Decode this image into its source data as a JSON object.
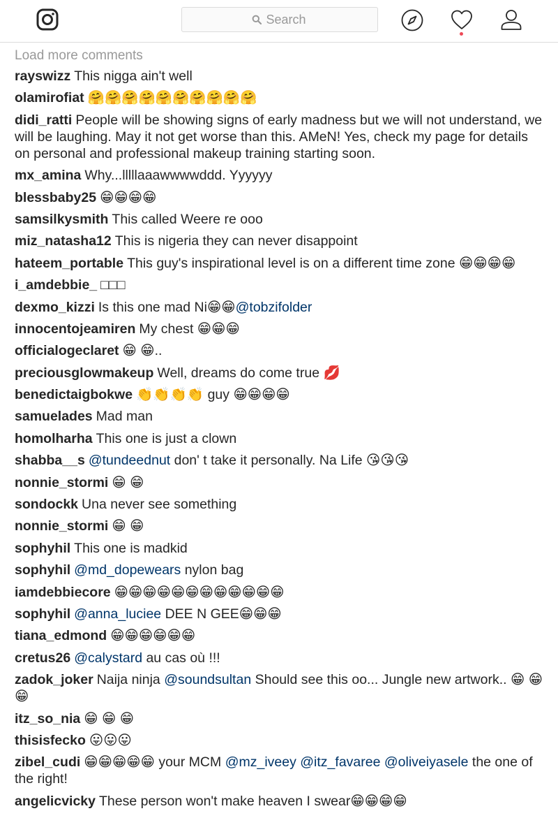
{
  "header": {
    "search_placeholder": "Search",
    "icons": [
      "instagram-logo-icon",
      "search-icon",
      "compass-icon",
      "heart-icon",
      "profile-icon"
    ],
    "notification_dot_color": "#ed4956"
  },
  "load_more_label": "Load more comments",
  "comments": [
    {
      "user": "rayswizz",
      "text": [
        {
          "t": "This nigga ain't well"
        }
      ]
    },
    {
      "user": "olamirofiat",
      "text": [
        {
          "t": "🤗🤗🤗🤗🤗🤗🤗🤗🤗🤗"
        }
      ]
    },
    {
      "user": "didi_ratti",
      "text": [
        {
          "t": "People will be showing signs of early madness but we will not understand, we will be laughing. May it not get worse than this. AMeN! Yes, check my page for details on personal and professional makeup training starting soon."
        }
      ]
    },
    {
      "user": "mx_amina",
      "text": [
        {
          "t": "Why...lllllaaawwwwddd. Yyyyyy"
        }
      ]
    },
    {
      "user": "blessbaby25",
      "text": [
        {
          "t": "😁😁😁😁"
        }
      ]
    },
    {
      "user": "samsilkysmith",
      "text": [
        {
          "t": "This called Weere re ooo"
        }
      ]
    },
    {
      "user": "miz_natasha12",
      "text": [
        {
          "t": "This is nigeria they can never disappoint"
        }
      ]
    },
    {
      "user": "hateem_portable",
      "text": [
        {
          "t": "This guy's inspirational level is on a different time zone 😁😁😁😁"
        }
      ]
    },
    {
      "user": "i_amdebbie_",
      "text": [
        {
          "t": "□□□"
        }
      ]
    },
    {
      "user": "dexmo_kizzi",
      "text": [
        {
          "t": "Is this one mad Ni😁😁"
        },
        {
          "t": "@tobzifolder",
          "m": true
        }
      ]
    },
    {
      "user": "innocentojeamiren",
      "text": [
        {
          "t": "My chest 😁😁😁"
        }
      ]
    },
    {
      "user": "officialogeclaret",
      "text": [
        {
          "t": "😁 😁.."
        }
      ]
    },
    {
      "user": "preciousglowmakeup",
      "text": [
        {
          "t": "Well, dreams do come true 💋"
        }
      ]
    },
    {
      "user": "benedictaigbokwe",
      "text": [
        {
          "t": "👏👏👏👏 guy 😁😁😁😁"
        }
      ]
    },
    {
      "user": "samuelades",
      "text": [
        {
          "t": "Mad man"
        }
      ]
    },
    {
      "user": "homolharha",
      "text": [
        {
          "t": "This one is just a clown"
        }
      ]
    },
    {
      "user": "shabba__s",
      "text": [
        {
          "t": "@tundeednut",
          "m": true
        },
        {
          "t": " don' t take it personally. Na Life 😘😘😘"
        }
      ]
    },
    {
      "user": "nonnie_stormi",
      "text": [
        {
          "t": "😁 😁"
        }
      ]
    },
    {
      "user": "sondockk",
      "text": [
        {
          "t": "Una never see something"
        }
      ]
    },
    {
      "user": "nonnie_stormi",
      "text": [
        {
          "t": "😁 😁"
        }
      ]
    },
    {
      "user": "sophyhil",
      "text": [
        {
          "t": "This one is madkid"
        }
      ]
    },
    {
      "user": "sophyhil",
      "text": [
        {
          "t": "@md_dopewears",
          "m": true
        },
        {
          "t": " nylon bag"
        }
      ]
    },
    {
      "user": "iamdebbiecore",
      "text": [
        {
          "t": "😁😁😁😁😁😁😁😁😁😁😁😁"
        }
      ]
    },
    {
      "user": "sophyhil",
      "text": [
        {
          "t": "@anna_luciee",
          "m": true
        },
        {
          "t": " DEE N GEE😁😁😁"
        }
      ]
    },
    {
      "user": "tiana_edmond",
      "text": [
        {
          "t": "😁😁😁😁😁😁"
        }
      ]
    },
    {
      "user": "cretus26",
      "text": [
        {
          "t": "@calystard",
          "m": true
        },
        {
          "t": " au cas où !!!"
        }
      ]
    },
    {
      "user": "zadok_joker",
      "text": [
        {
          "t": "Naija ninja "
        },
        {
          "t": "@soundsultan",
          "m": true
        },
        {
          "t": " Should see this oo... Jungle new artwork.. 😁 😁 😁"
        }
      ]
    },
    {
      "user": "itz_so_nia",
      "text": [
        {
          "t": "😁 😁 😁"
        }
      ]
    },
    {
      "user": "thisisfecko",
      "text": [
        {
          "t": "😛😛😛"
        }
      ]
    },
    {
      "user": "zibel_cudi",
      "text": [
        {
          "t": "😁😁😁😁😁 your MCM "
        },
        {
          "t": "@mz_iveey",
          "m": true
        },
        {
          "t": " "
        },
        {
          "t": "@itz_favaree",
          "m": true
        },
        {
          "t": " "
        },
        {
          "t": "@oliveiyasele",
          "m": true
        },
        {
          "t": " the one of the right!"
        }
      ]
    },
    {
      "user": "angelicvicky",
      "text": [
        {
          "t": "These person won't make heaven I swear😁😁😁😁"
        }
      ]
    }
  ]
}
